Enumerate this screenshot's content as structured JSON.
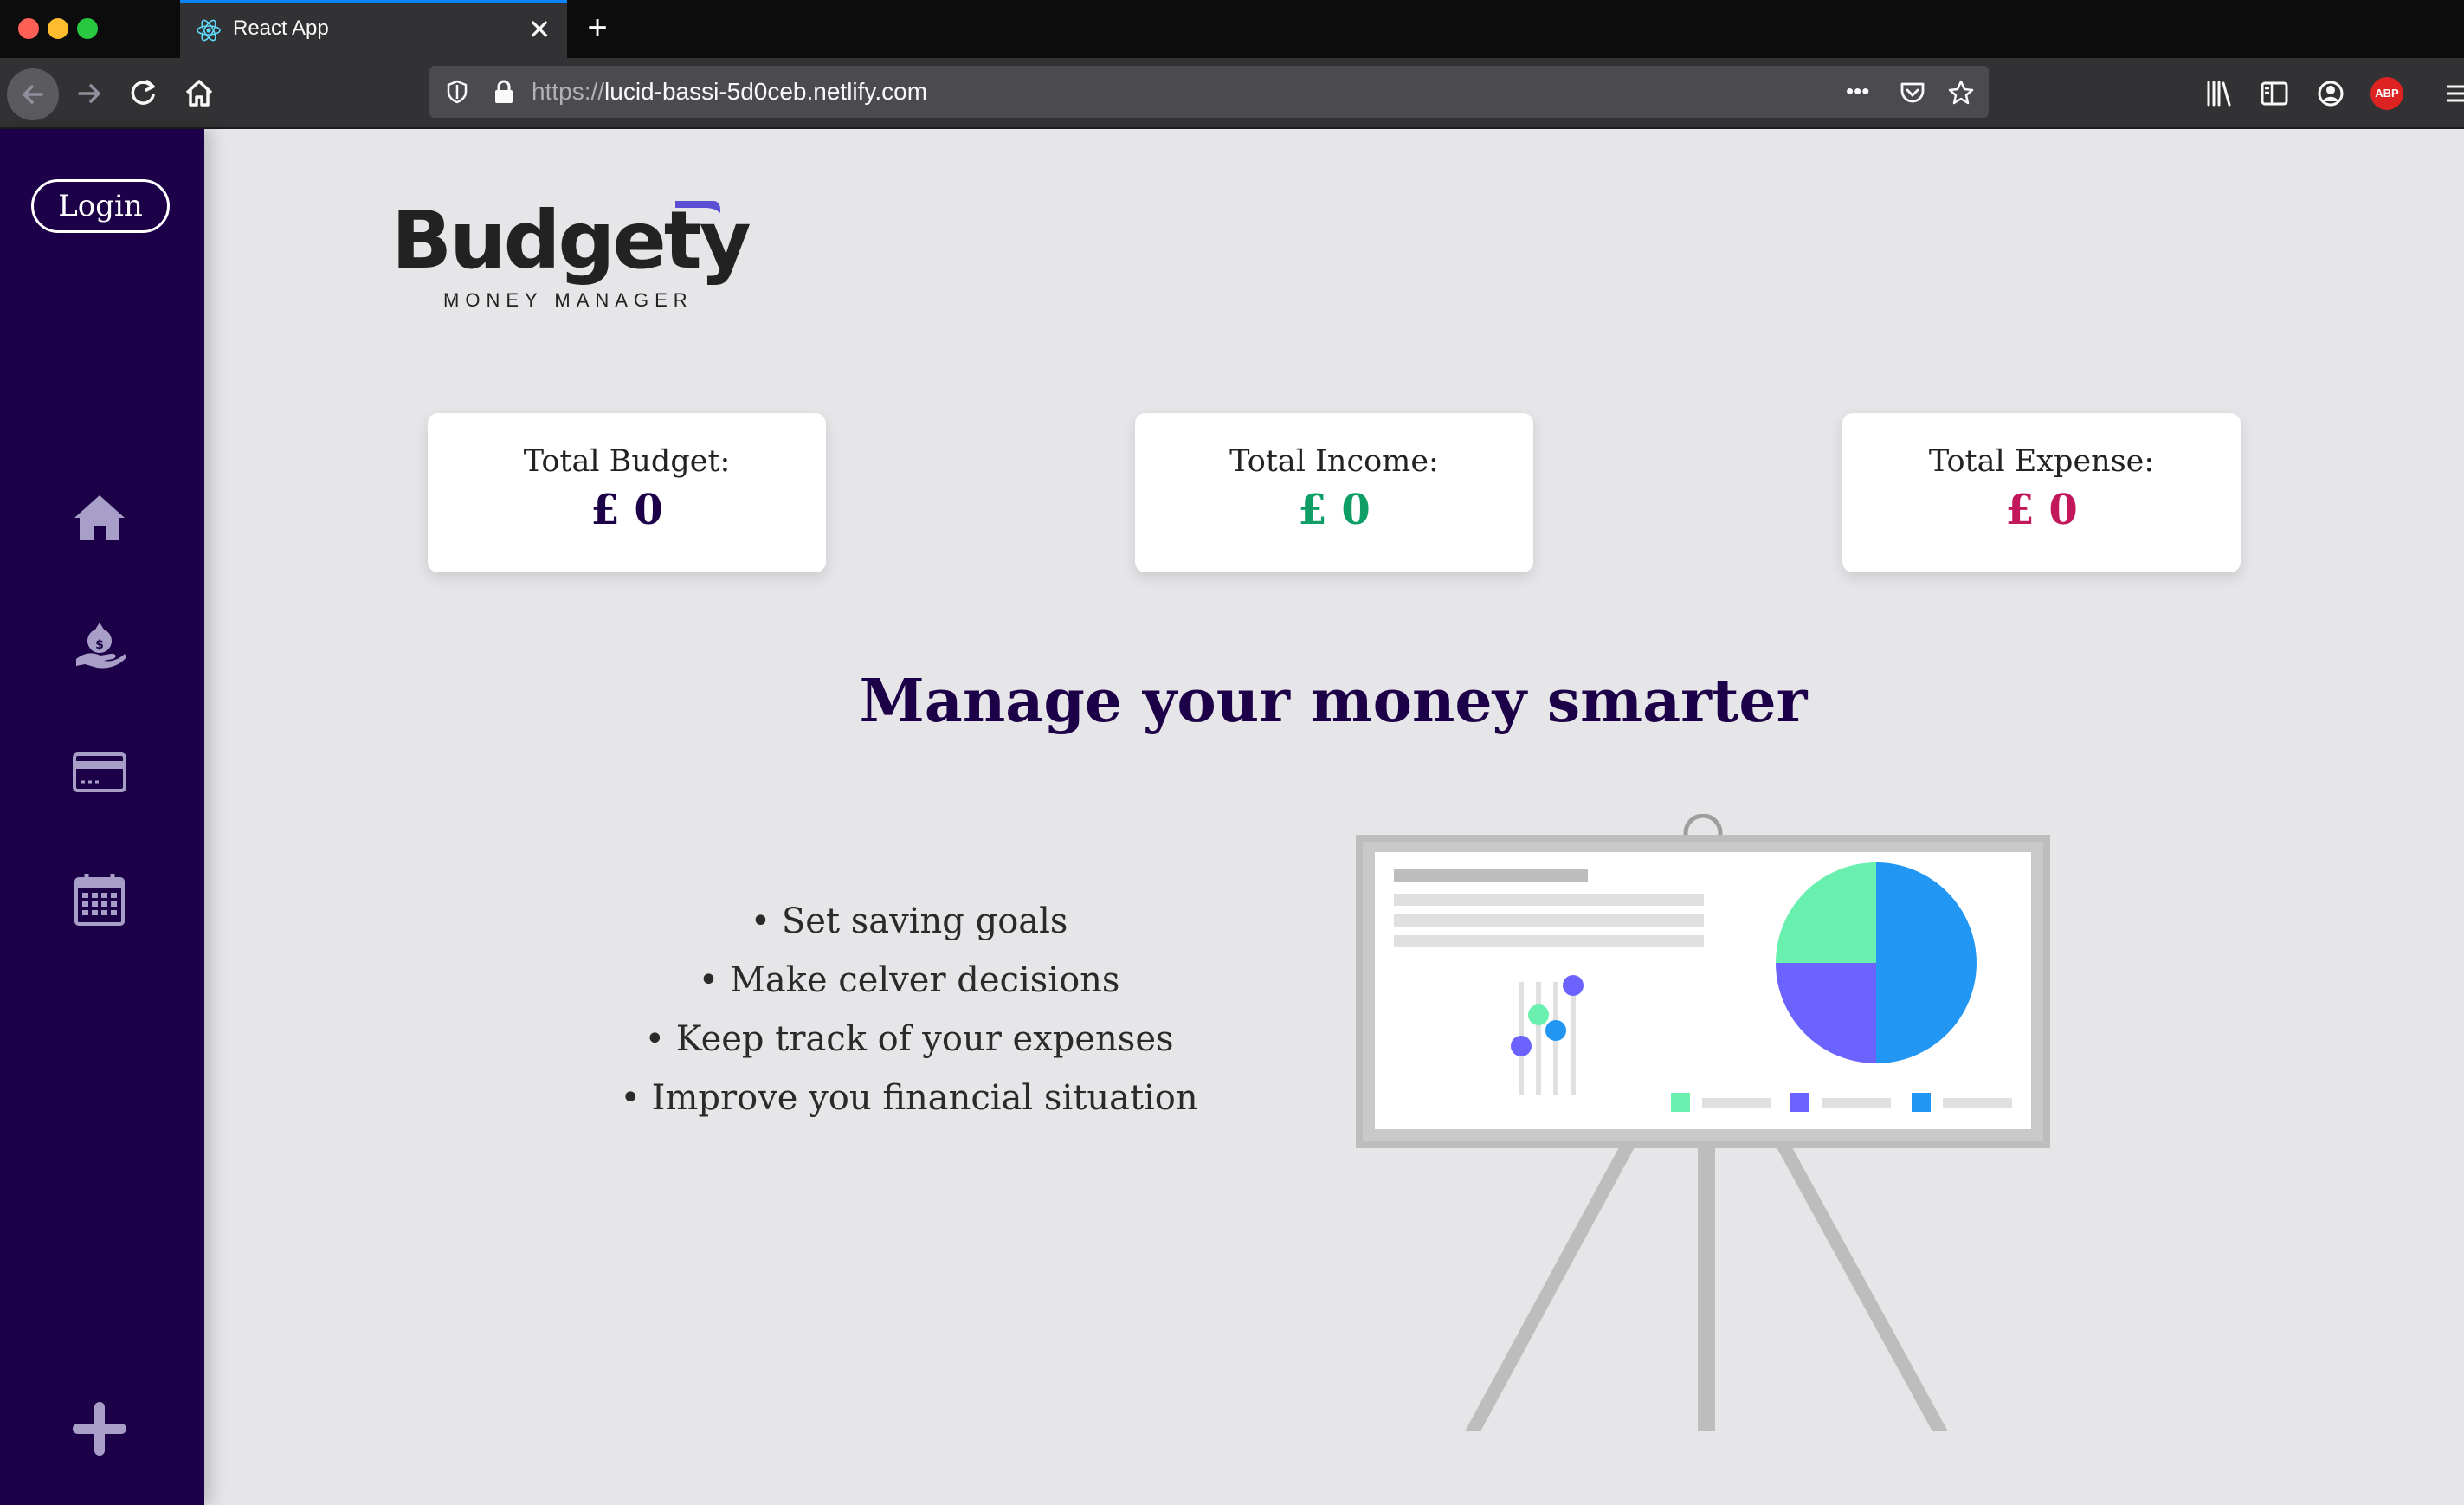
{
  "browser": {
    "tab_title": "React App",
    "tab_close": "✕",
    "new_tab": "+",
    "url_protocol": "https://",
    "url_host": "lucid-bassi-5d0ceb.netlify.com",
    "url_overflow": "•••",
    "addon_abp": "ABP",
    "accent": "#0a84ff"
  },
  "sidebar": {
    "login_label": "Login",
    "background": "#1d0148",
    "icons": [
      "home-icon",
      "money-bag-hand-icon",
      "credit-card-icon",
      "calendar-icon",
      "plus-icon"
    ]
  },
  "logo": {
    "word": "Budgety",
    "tagline": "MONEY MANAGER",
    "flag_color": "#5b4fd6"
  },
  "summary": {
    "budget": {
      "label": "Total Budget:",
      "value": "£ 0",
      "color": "#1d0148"
    },
    "income": {
      "label": "Total Income:",
      "value": "£ 0",
      "color": "#0f9e66"
    },
    "expense": {
      "label": "Total Expense:",
      "value": "£ 0",
      "color": "#c2185b"
    }
  },
  "headline": "Manage your money smarter",
  "features": [
    "Set saving goals",
    "Make celver decisions",
    "Keep track of your expenses",
    "Improve you financial situation"
  ],
  "illustration": {
    "pie_colors": [
      "#2196f3",
      "#6c63ff",
      "#69f0ae"
    ],
    "pie_shares": [
      0.5,
      0.25,
      0.25
    ]
  }
}
